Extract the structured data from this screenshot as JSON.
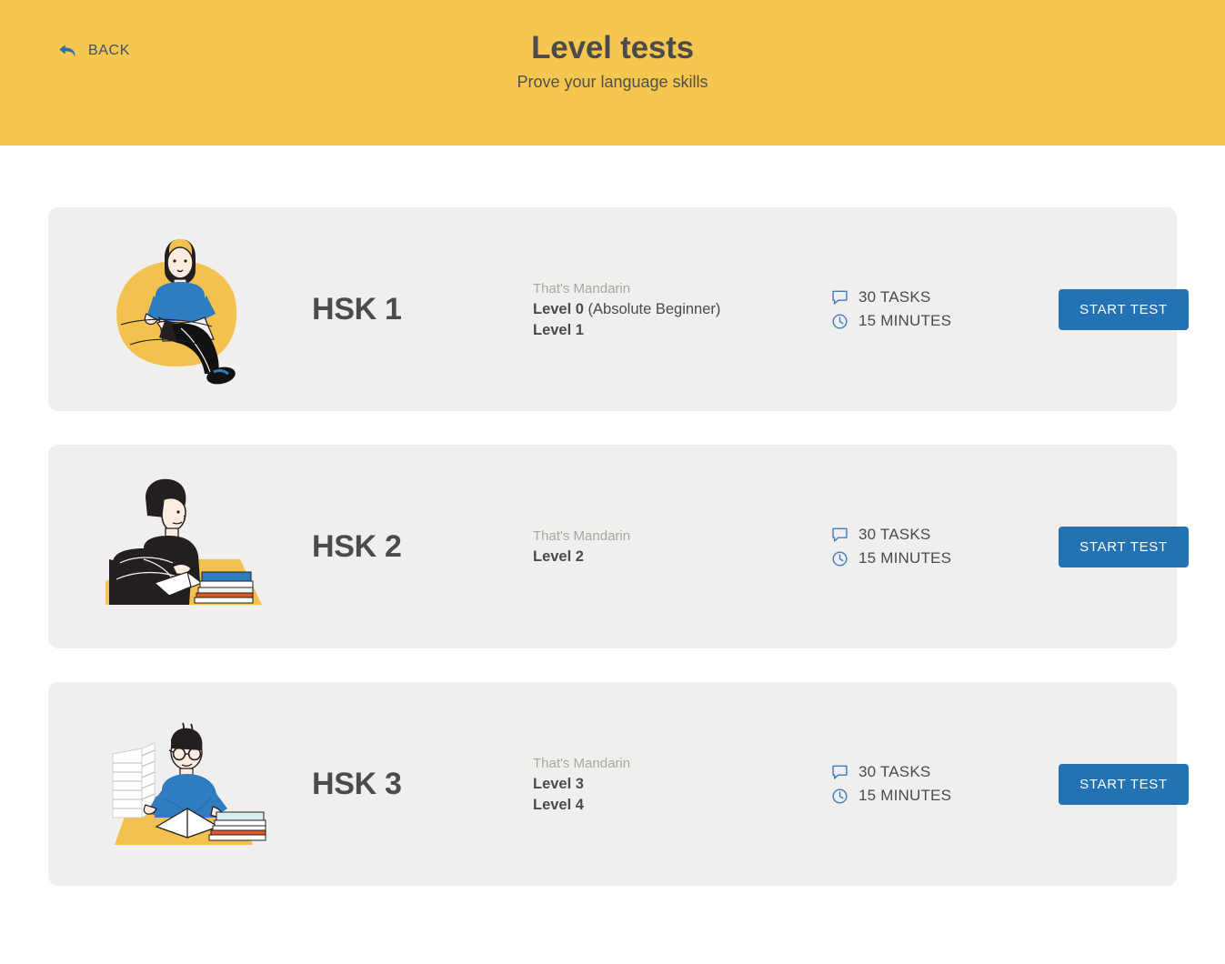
{
  "header": {
    "back_label": "BACK",
    "back_icon": "back-arrow-icon",
    "title": "Level tests",
    "subtitle": "Prove your language skills",
    "background_color": "#f5c751"
  },
  "theme": {
    "accent_yellow": "#f5c751",
    "button_blue": "#2272b4",
    "icon_blue": "#3d7ebc",
    "card_background": "#f0efed",
    "text_dark": "#4b4b4b",
    "text_muted": "#a8a7a4"
  },
  "cards": [
    {
      "code": "HSK 1",
      "provider": "That's Mandarin",
      "levels": [
        {
          "label": "Level 0",
          "note": " (Absolute Beginner)"
        },
        {
          "label": "Level 1",
          "note": ""
        }
      ],
      "tasks": "30 TASKS",
      "duration": "15 MINUTES",
      "tasks_icon": "speech-bubble-icon",
      "duration_icon": "clock-icon",
      "button_label": "START TEST",
      "illustration": "person-with-laptop-on-beanbag"
    },
    {
      "code": "HSK 2",
      "provider": "That's Mandarin",
      "levels": [
        {
          "label": "Level 2",
          "note": ""
        }
      ],
      "tasks": "30 TASKS",
      "duration": "15 MINUTES",
      "tasks_icon": "speech-bubble-icon",
      "duration_icon": "clock-icon",
      "button_label": "START TEST",
      "illustration": "person-reading-at-desk"
    },
    {
      "code": "HSK 3",
      "provider": "That's Mandarin",
      "levels": [
        {
          "label": "Level 3",
          "note": ""
        },
        {
          "label": "Level 4",
          "note": ""
        }
      ],
      "tasks": "30 TASKS",
      "duration": "15 MINUTES",
      "tasks_icon": "speech-bubble-icon",
      "duration_icon": "clock-icon",
      "button_label": "START TEST",
      "illustration": "person-with-glasses-and-book-stacks"
    }
  ]
}
